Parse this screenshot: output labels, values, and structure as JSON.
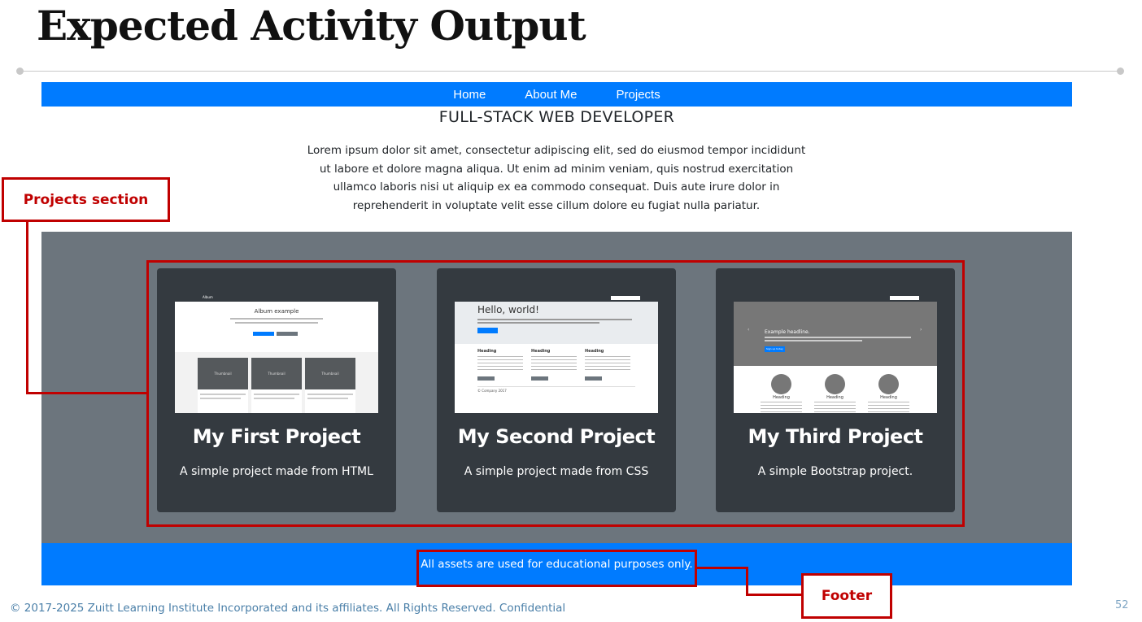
{
  "slide": {
    "title": "Expected Activity Output",
    "copyright": "© 2017-2025 Zuitt Learning Institute Incorporated and its affiliates. All Rights Reserved. Confidential",
    "page_number": "52"
  },
  "navbar": {
    "links": [
      "Home",
      "About Me",
      "Projects"
    ]
  },
  "hero": {
    "title": "FULL-STACK WEB DEVELOPER",
    "text": "Lorem ipsum dolor sit amet, consectetur adipiscing elit, sed do eiusmod tempor incididunt ut labore et dolore magna aliqua. Ut enim ad minim veniam, quis nostrud exercitation ullamco laboris nisi ut aliquip ex ea commodo consequat. Duis aute irure dolor in reprehenderit in voluptate velit esse cillum dolore eu fugiat nulla pariatur."
  },
  "projects": [
    {
      "title": "My First Project",
      "description": "A simple project made from HTML",
      "thumb": {
        "brand": "Album",
        "heading": "Album example",
        "thumbnail_label": "Thumbnail"
      }
    },
    {
      "title": "My Second Project",
      "description": "A simple project made from CSS",
      "thumb": {
        "heading": "Hello, world!",
        "column_heading": "Heading",
        "footer": "© Company 2017"
      }
    },
    {
      "title": "My Third Project",
      "description": "A simple Bootstrap project.",
      "thumb": {
        "headline": "Example headline.",
        "column_heading": "Heading",
        "button": "Sign up today"
      }
    }
  ],
  "footer": {
    "text": "All assets are used for educational purposes only."
  },
  "annotations": {
    "projects_label": "Projects section",
    "footer_label": "Footer"
  },
  "colors": {
    "primary": "#007bff",
    "section_bg": "#6c757d",
    "card_bg": "#343a40",
    "annotation": "#c00000"
  }
}
